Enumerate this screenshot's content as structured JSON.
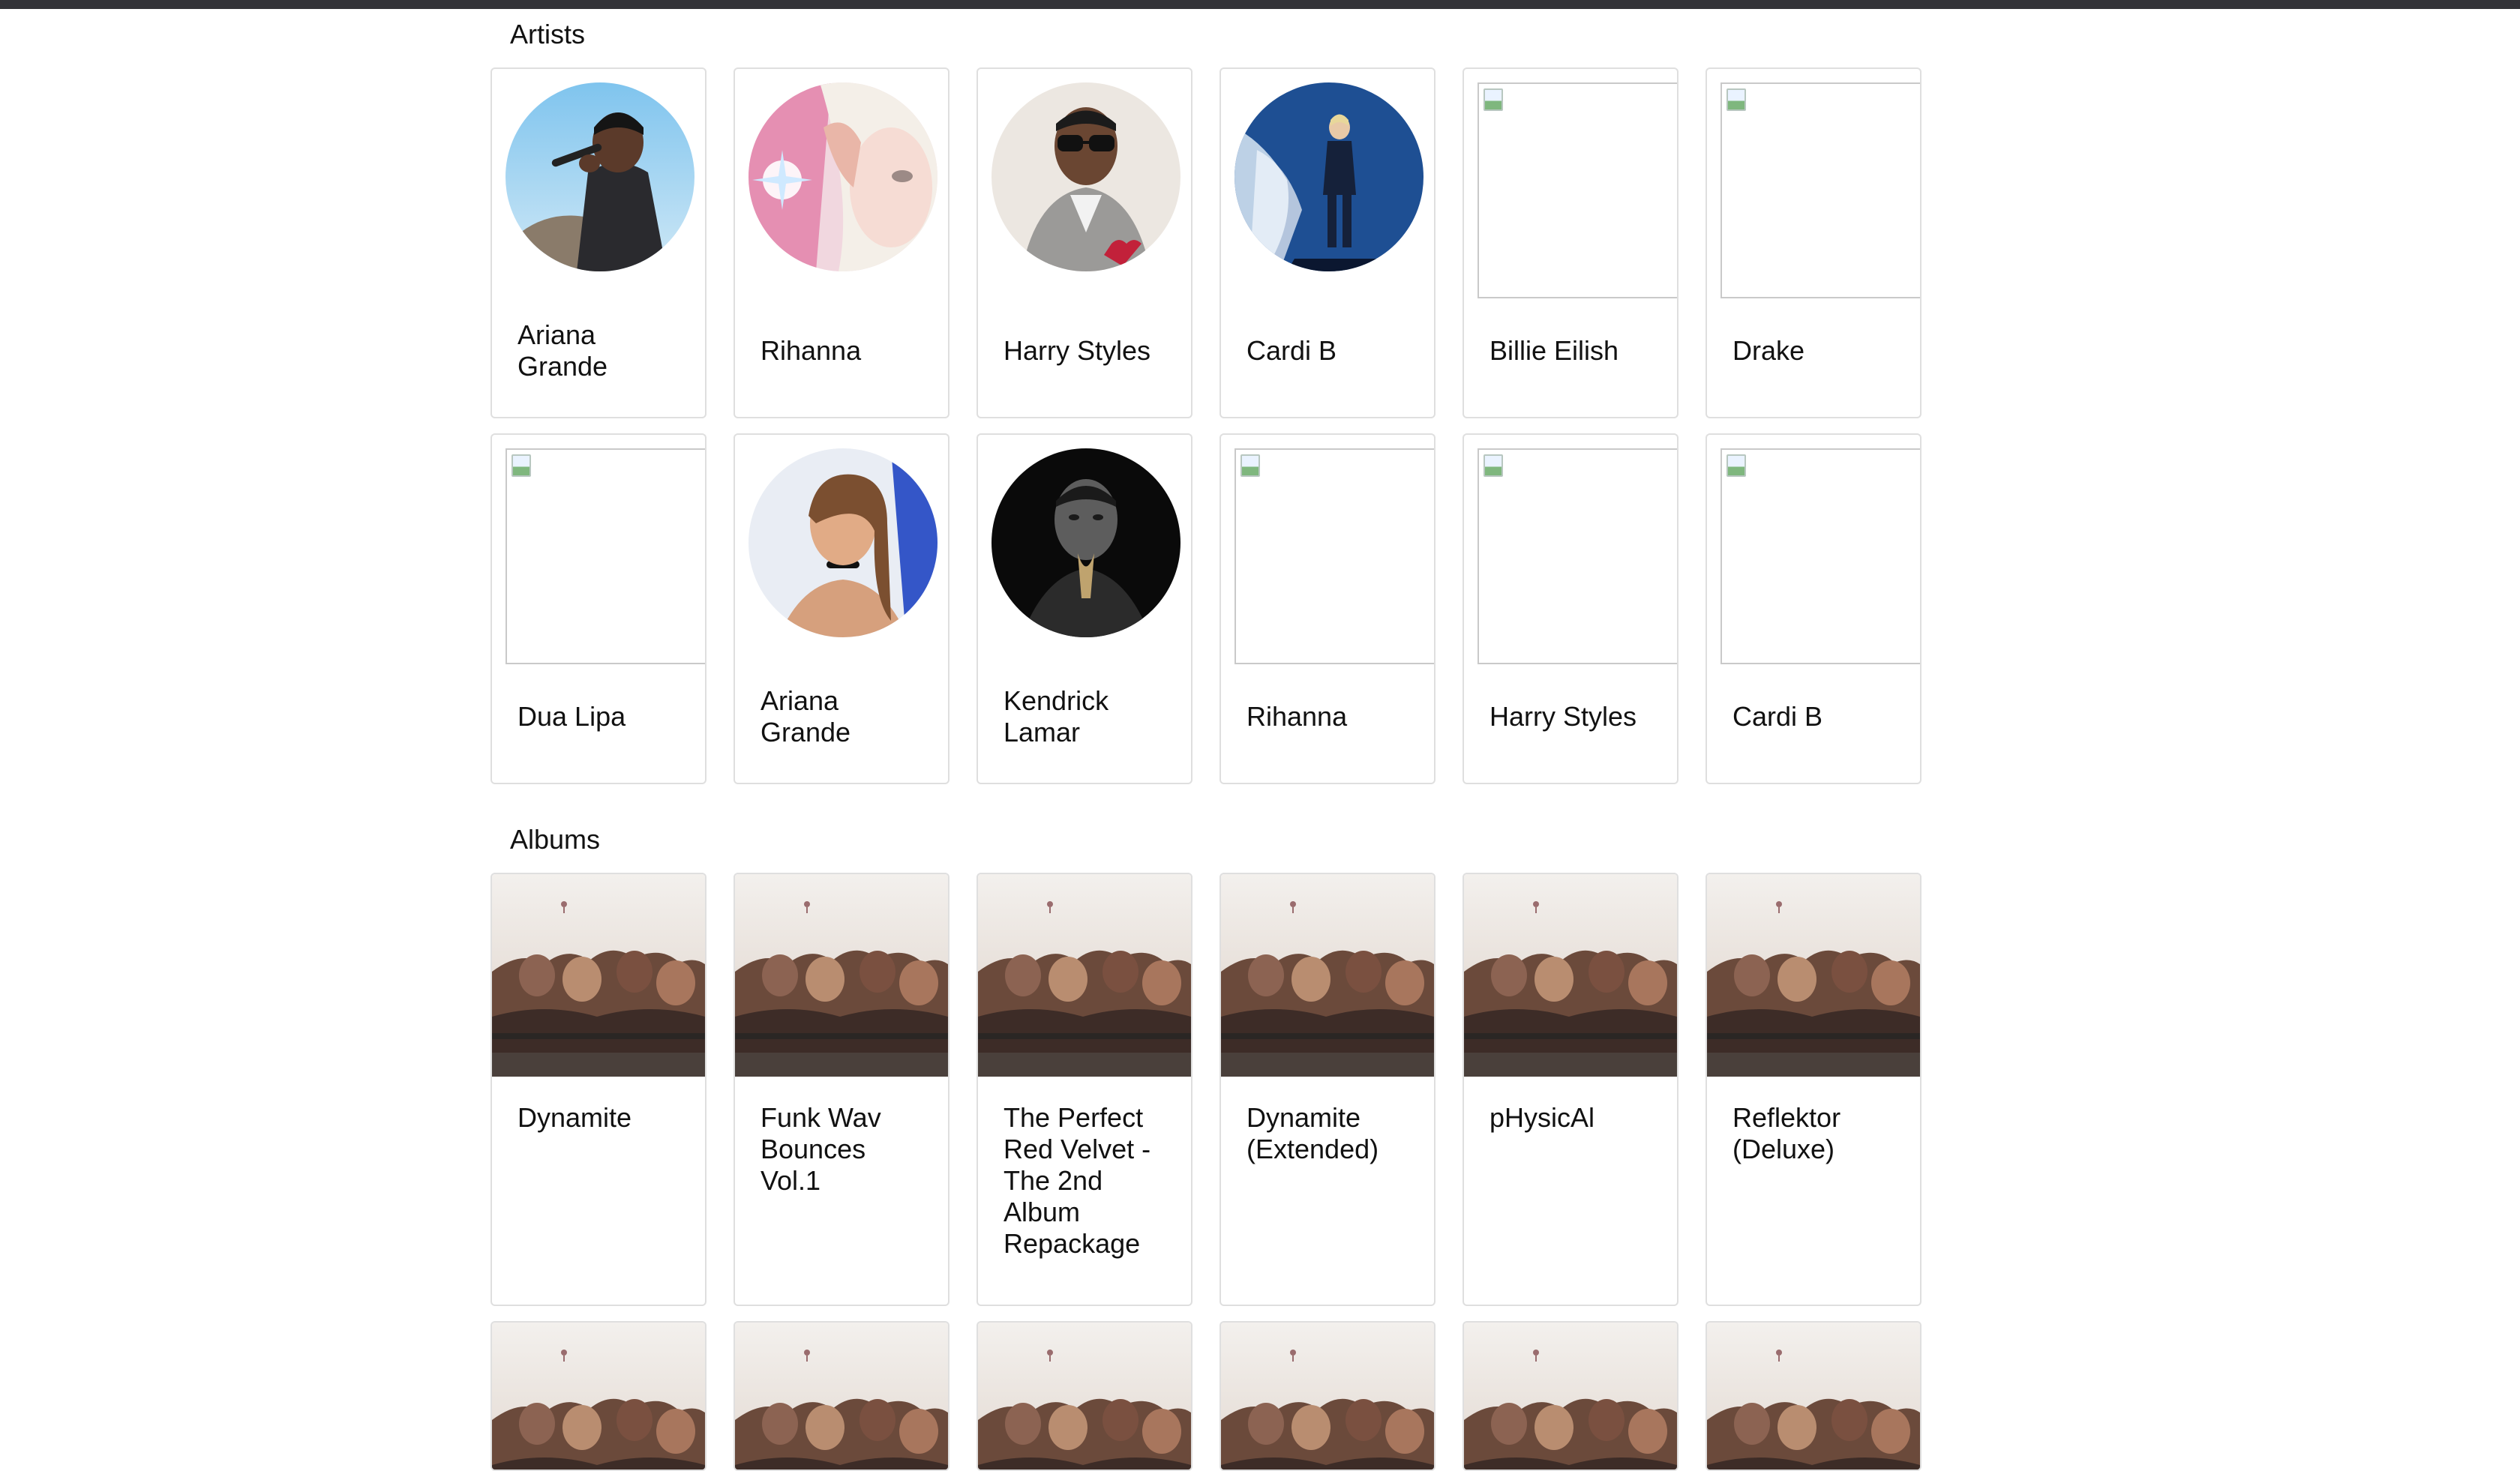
{
  "sections": {
    "artists_title": "Artists",
    "albums_title": "Albums"
  },
  "artists": [
    {
      "name": "Ariana Grande",
      "image": "photo-singer-with-microphone"
    },
    {
      "name": "Rihanna",
      "image": "photo-pink-portrait"
    },
    {
      "name": "Harry Styles",
      "image": "photo-man-sunglasses-suit"
    },
    {
      "name": "Cardi B",
      "image": "photo-stage-performer"
    },
    {
      "name": "Billie Eilish",
      "image": "broken-image"
    },
    {
      "name": "Drake",
      "image": "broken-image"
    },
    {
      "name": "Dua Lipa",
      "image": "broken-image"
    },
    {
      "name": "Ariana Grande",
      "image": "photo-ponytail-portrait"
    },
    {
      "name": "Kendrick Lamar",
      "image": "photo-bw-portrait"
    },
    {
      "name": "Rihanna",
      "image": "broken-image"
    },
    {
      "name": "Harry Styles",
      "image": "broken-image"
    },
    {
      "name": "Cardi B",
      "image": "broken-image"
    }
  ],
  "albums": [
    {
      "name": "Dynamite"
    },
    {
      "name": "Funk Wav Bounces Vol.1"
    },
    {
      "name": "The Perfect Red Velvet - The 2nd Album Repackage"
    },
    {
      "name": "Dynamite (Extended)"
    },
    {
      "name": "pHysicAl"
    },
    {
      "name": "Reflektor (Deluxe)"
    }
  ],
  "albums_next_row_count": 6,
  "colors": {
    "topbar": "#333338",
    "card_border": "#dcdcdc",
    "text": "#111111"
  }
}
